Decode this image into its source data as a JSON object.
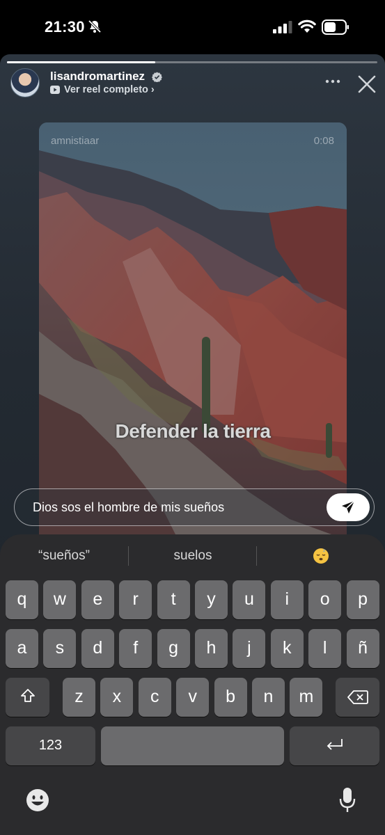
{
  "status_bar": {
    "time": "21:30",
    "icons": [
      "bell-slash-icon",
      "signal-icon",
      "wifi-icon",
      "battery-icon"
    ]
  },
  "story": {
    "progress": 0.4,
    "username": "lisandromartinez",
    "verified": true,
    "reel_link": "Ver reel completo ›",
    "actions": [
      "more-icon",
      "close-icon"
    ]
  },
  "reel": {
    "author": "amnistiaar",
    "duration": "0:08",
    "caption": "Defender la tierra"
  },
  "message": {
    "text": "Dios sos el hombre de mis sueños",
    "send_icon": "send-icon"
  },
  "keyboard": {
    "suggestions": [
      "“sueños”",
      "suelos",
      "😴"
    ],
    "row1": [
      "q",
      "w",
      "e",
      "r",
      "t",
      "y",
      "u",
      "i",
      "o",
      "p"
    ],
    "row2": [
      "a",
      "s",
      "d",
      "f",
      "g",
      "h",
      "j",
      "k",
      "l",
      "ñ"
    ],
    "row3": [
      "z",
      "x",
      "c",
      "v",
      "b",
      "n",
      "m"
    ],
    "numbers_key": "123",
    "bottom_icons": [
      "emoji-icon",
      "microphone-icon"
    ]
  },
  "colors": {
    "keyboard_bg": "#2b2b2d",
    "key": "#6b6b6d",
    "key_dark": "#464648",
    "story_bg": "#2d3640"
  }
}
